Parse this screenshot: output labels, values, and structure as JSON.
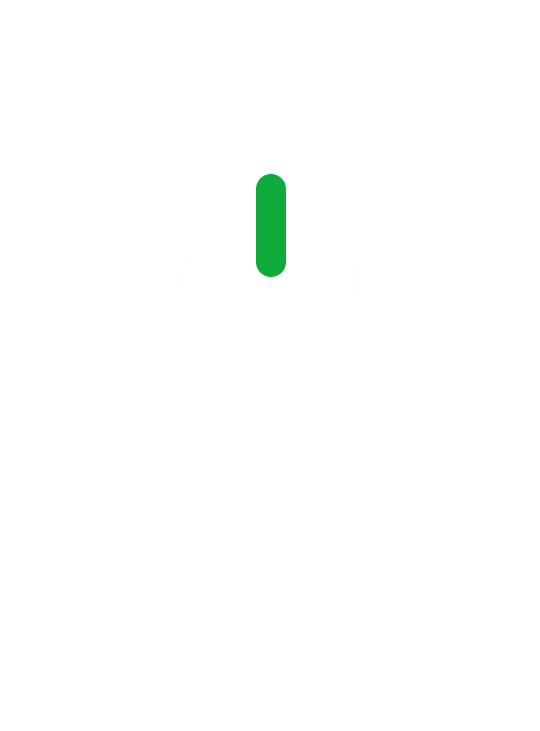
{
  "screen": {
    "background": "#ffffff"
  },
  "power_icon": {
    "name": "power-icon",
    "bar_color": "#0eab3a",
    "ring_color": "#ffffff"
  },
  "caption": {
    "line_1": "",
    "line_2": ""
  }
}
